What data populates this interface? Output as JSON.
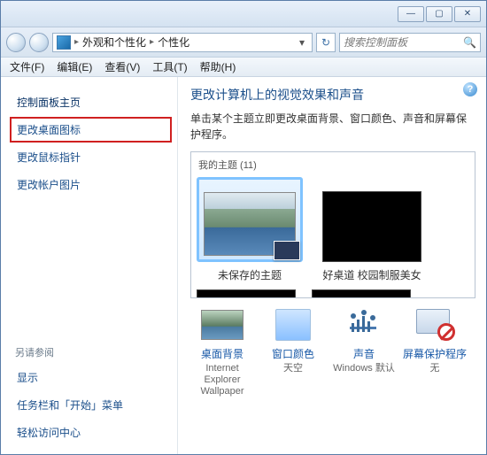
{
  "titlebar": {
    "min": "—",
    "max": "▢",
    "close": "✕"
  },
  "address": {
    "seg1": "外观和个性化",
    "seg2": "个性化",
    "search_placeholder": "搜索控制面板",
    "refresh_glyph": "↻",
    "search_glyph": "🔍",
    "sep": "▸",
    "drop": "▾"
  },
  "menubar": {
    "file": "文件(F)",
    "edit": "编辑(E)",
    "view": "查看(V)",
    "tools": "工具(T)",
    "help": "帮助(H)"
  },
  "sidebar": {
    "home": "控制面板主页",
    "change_icons": "更改桌面图标",
    "change_pointer": "更改鼠标指针",
    "change_avatar": "更改帐户图片",
    "see_also_title": "另请参阅",
    "display": "显示",
    "taskbar": "任务栏和「开始」菜单",
    "ease": "轻松访问中心"
  },
  "main": {
    "help": "?",
    "heading": "更改计算机上的视觉效果和声音",
    "desc": "单击某个主题立即更改桌面背景、窗口颜色、声音和屏幕保护程序。",
    "themes_title": "我的主题 (11)",
    "theme_unsaved": "未保存的主题",
    "theme_good": "好桌道 校园制服美女"
  },
  "opts": {
    "bg_label": "桌面背景",
    "bg_sub": "Internet Explorer Wallpaper",
    "color_label": "窗口颜色",
    "color_sub": "天空",
    "sound_label": "声音",
    "sound_sub": "Windows 默认",
    "saver_label": "屏幕保护程序",
    "saver_sub": "无"
  }
}
